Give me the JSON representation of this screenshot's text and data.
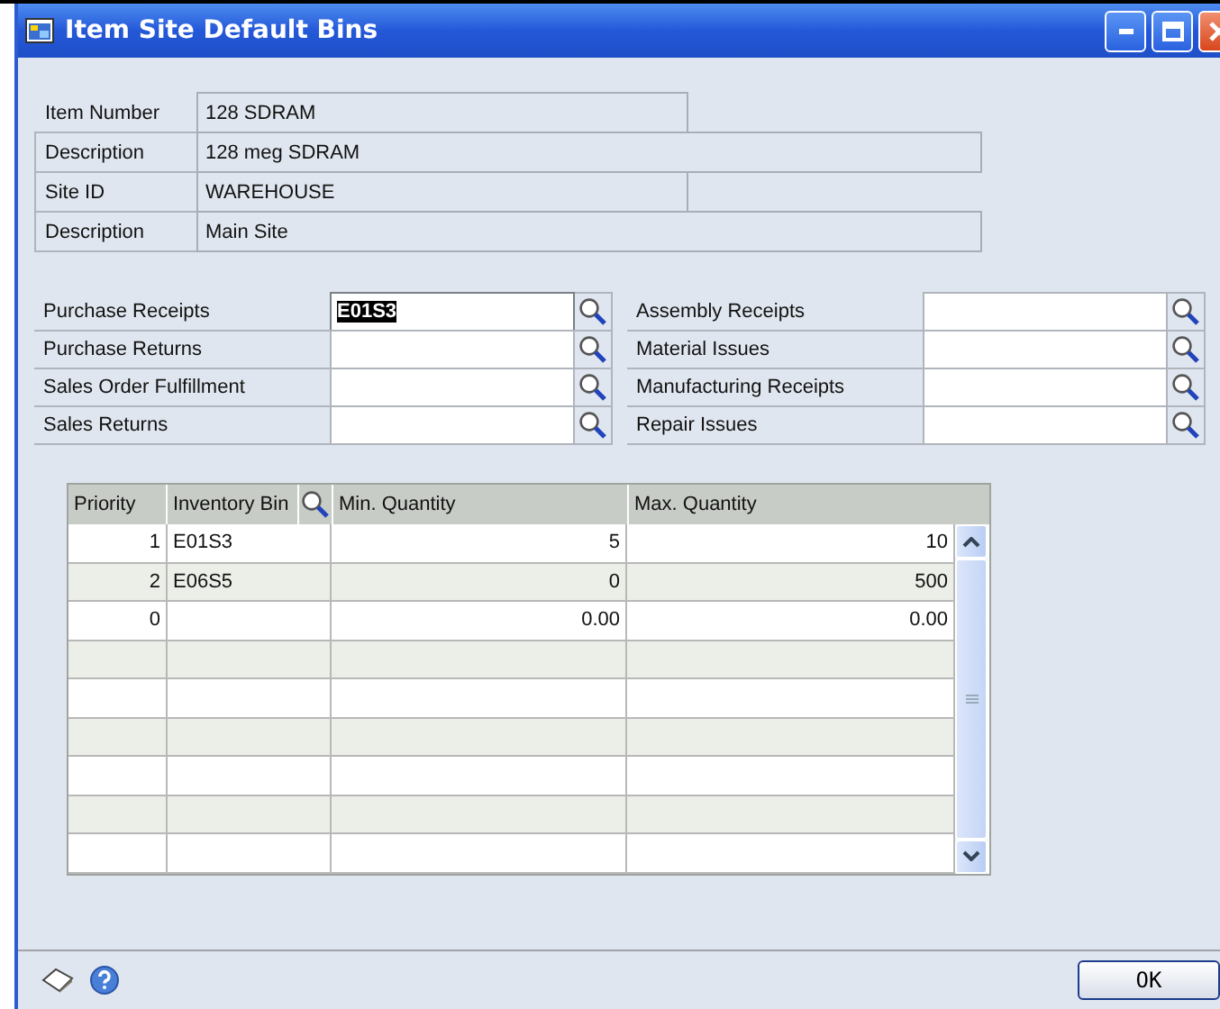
{
  "window": {
    "title": "Item Site Default Bins"
  },
  "info": [
    {
      "label": "Item Number",
      "value": "128 SDRAM",
      "wide": false
    },
    {
      "label": "Description",
      "value": "128 meg SDRAM",
      "wide": true
    },
    {
      "label": "Site ID",
      "value": "WAREHOUSE",
      "wide": false
    },
    {
      "label": "Description",
      "value": "Main Site",
      "wide": true
    }
  ],
  "bins_left": [
    {
      "label": "Purchase Receipts",
      "value": "E01S3",
      "selected": true
    },
    {
      "label": "Purchase Returns",
      "selected": false
    },
    {
      "label": "Sales Order Fulfillment",
      "selected": false
    },
    {
      "label": "Sales Returns",
      "selected": false
    }
  ],
  "bins_right": [
    {
      "label": "Assembly Receipts",
      "selected": false
    },
    {
      "label": "Material Issues",
      "selected": false
    },
    {
      "label": "Manufacturing Receipts",
      "selected": false
    },
    {
      "label": "Repair Issues",
      "selected": false
    }
  ],
  "table": {
    "columns": [
      "Priority",
      "Inventory Bin",
      "Min. Quantity",
      "Max. Quantity"
    ],
    "rows": [
      {
        "priority": "1",
        "bin": "E01S3",
        "min": "5",
        "max": "10"
      },
      {
        "priority": "2",
        "bin": "E06S5",
        "min": "0",
        "max": "500"
      },
      {
        "priority": "0",
        "min": "0.00",
        "max": "0.00"
      }
    ]
  },
  "buttons": [
    "OK"
  ]
}
